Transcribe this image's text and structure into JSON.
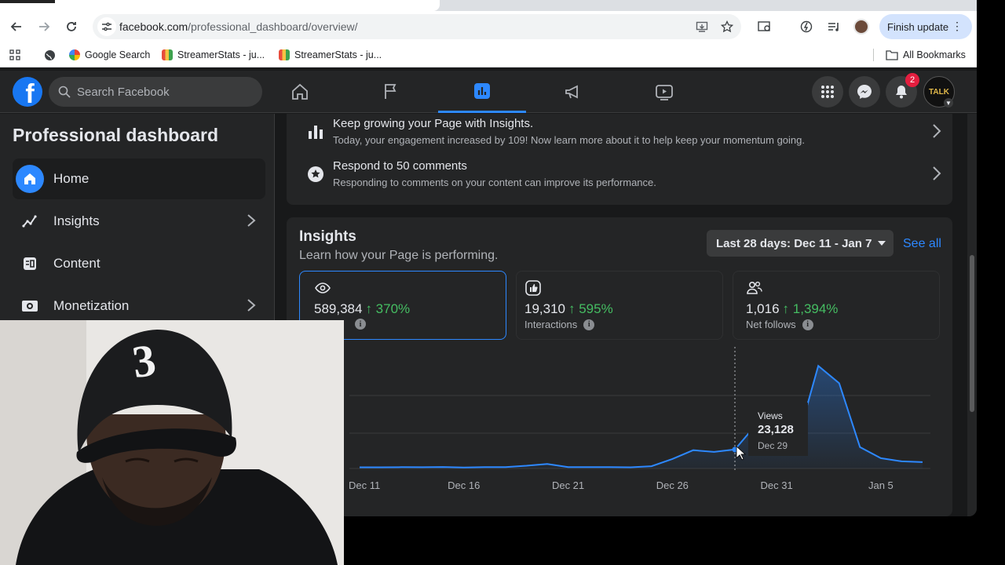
{
  "browser": {
    "url_domain": "facebook.com",
    "url_path": "/professional_dashboard/overview/",
    "finish_update_label": "Finish update",
    "bookmarks": [
      {
        "label": "Google Search",
        "color": "#4285f4"
      },
      {
        "label": "StreamerStats - ju...",
        "color": "#e8a33d"
      },
      {
        "label": "StreamerStats - ju...",
        "color": "#e8a33d"
      }
    ],
    "all_bookmarks_label": "All Bookmarks"
  },
  "fb_header": {
    "logo_letter": "f",
    "search_placeholder": "Search Facebook",
    "notification_count": "2",
    "account_label": "TALK",
    "nav_items": [
      "home-icon",
      "flag-icon",
      "dashboard-icon",
      "megaphone-icon",
      "video-icon"
    ]
  },
  "sidebar": {
    "title": "Professional dashboard",
    "items": [
      {
        "label": "Home",
        "icon": "home-icon",
        "active": true,
        "chevron": false
      },
      {
        "label": "Insights",
        "icon": "insights-icon",
        "active": false,
        "chevron": true
      },
      {
        "label": "Content",
        "icon": "content-icon",
        "active": false,
        "chevron": false
      },
      {
        "label": "Monetization",
        "icon": "monetization-icon",
        "active": false,
        "chevron": true
      }
    ]
  },
  "todo": [
    {
      "title": "Keep growing your Page with Insights.",
      "subtitle": "Today, your engagement increased by 109! Now learn more about it to help keep your momentum going."
    },
    {
      "title": "Respond to 50 comments",
      "subtitle": "Responding to comments on your content can improve its performance."
    }
  ],
  "insights": {
    "title": "Insights",
    "subtitle": "Learn how your Page is performing.",
    "date_range": "Last 28 days: Dec 11 - Jan 7",
    "see_all": "See all",
    "metrics": [
      {
        "value": "589,384",
        "change": "↑ 370%",
        "label": "",
        "icon": "eye-icon",
        "active": true
      },
      {
        "value": "19,310",
        "change": "↑ 595%",
        "label": "Interactions",
        "icon": "like-icon",
        "active": false
      },
      {
        "value": "1,016",
        "change": "↑ 1,394%",
        "label": "Net follows",
        "icon": "people-icon",
        "active": false
      }
    ],
    "tooltip": {
      "label": "Views",
      "value": "23,128",
      "date": "Dec 29"
    }
  },
  "colors": {
    "accent": "#2d88ff",
    "positive": "#45bd62",
    "badge": "#e41e3f"
  },
  "chart_data": {
    "type": "area",
    "series": [
      {
        "name": "Views",
        "x": [
          "Dec 11",
          "Dec 12",
          "Dec 13",
          "Dec 14",
          "Dec 15",
          "Dec 16",
          "Dec 17",
          "Dec 18",
          "Dec 19",
          "Dec 20",
          "Dec 21",
          "Dec 22",
          "Dec 23",
          "Dec 24",
          "Dec 25",
          "Dec 26",
          "Dec 27",
          "Dec 28",
          "Dec 29",
          "Dec 30",
          "Dec 31",
          "Jan 1",
          "Jan 2",
          "Jan 3",
          "Jan 4",
          "Jan 5",
          "Jan 6",
          "Jan 7"
        ],
        "values": [
          1500,
          1500,
          1700,
          1600,
          1900,
          1300,
          1700,
          1800,
          3500,
          5800,
          1800,
          1800,
          1700,
          1500,
          2900,
          12000,
          23128,
          21000,
          24000,
          55000,
          53000,
          36000,
          130000,
          108000,
          27000,
          13000,
          9000,
          8000
        ]
      }
    ],
    "x_ticks": [
      "Dec 11",
      "Dec 16",
      "Dec 21",
      "Dec 26",
      "Dec 31",
      "Jan 5"
    ],
    "grid": true
  }
}
